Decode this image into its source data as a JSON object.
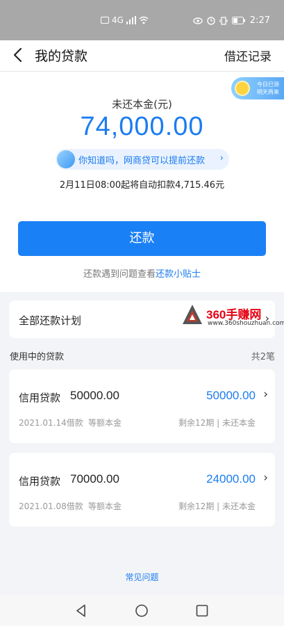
{
  "status_bar": {
    "network": "4G",
    "time": "2:27"
  },
  "header": {
    "title": "我的贷款",
    "records_link": "借还记录"
  },
  "promo_badge": {
    "line1": "今日已领",
    "line2": "明天再来"
  },
  "summary": {
    "remaining_label": "未还本金(元)",
    "remaining_amount": "74,000.00",
    "tip": "你知道吗，网商贷可以提前还款",
    "auto_deduct": "2月11日08:00起将自动扣款4,715.46元"
  },
  "repay_button": "还款",
  "help": {
    "prefix": "还款遇到问题查看",
    "link": "还款小贴士"
  },
  "plan": {
    "label": "全部还款计划"
  },
  "watermark": {
    "title": "360手赚网",
    "url": "www.360shouzhuan.com"
  },
  "loans_section": {
    "title": "使用中的贷款",
    "count": "共2笔",
    "items": [
      {
        "name": "信用贷款",
        "principal": "50000.00",
        "remaining": "50000.00",
        "date": "2021.01.14借款",
        "method": "等额本金",
        "terms": "剩余12期 | 未还本金"
      },
      {
        "name": "信用贷款",
        "principal": "70000.00",
        "remaining": "24000.00",
        "date": "2021.01.08借款",
        "method": "等额本金",
        "terms": "剩余12期 | 未还本金"
      }
    ]
  },
  "faq": "常见问题",
  "colors": {
    "accent": "#1b7cf0",
    "button": "#1a80f5",
    "background": "#f2f4f7"
  }
}
